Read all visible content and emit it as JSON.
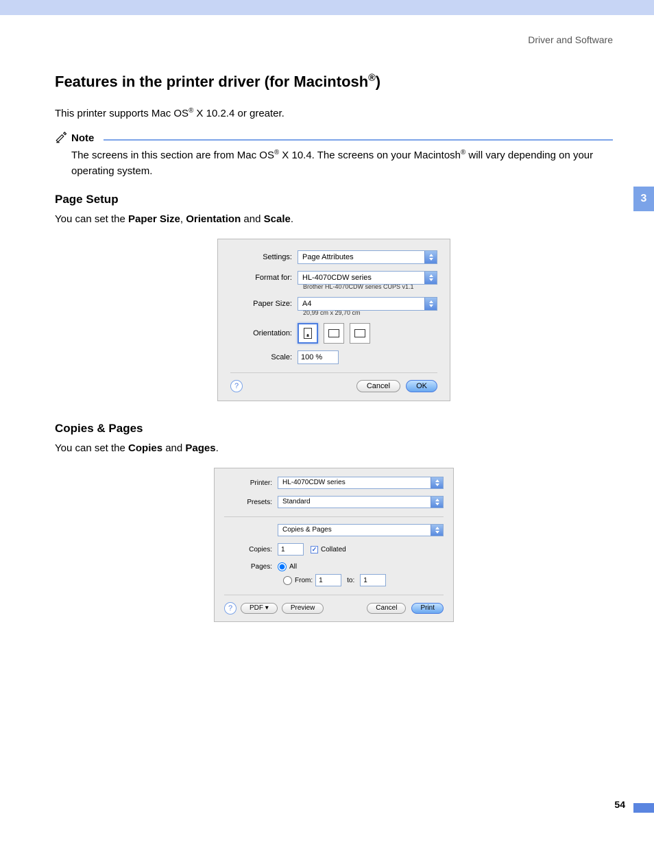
{
  "header": {
    "breadcrumb": "Driver and Software"
  },
  "chapter_tab": "3",
  "page_number": "54",
  "title_prefix": "Features in the printer driver (for Macintosh",
  "title_sup": "®",
  "title_suffix": ")",
  "intro_prefix": "This printer supports Mac OS",
  "intro_sup": "®",
  "intro_suffix": " X 10.2.4 or greater.",
  "note": {
    "label": "Note",
    "body_prefix": "The screens in this section are from Mac OS",
    "body_sup1": "®",
    "body_mid": " X 10.4. The screens on your Macintosh",
    "body_sup2": "®",
    "body_suffix": " will vary depending on your operating system."
  },
  "pagesetup": {
    "heading": "Page Setup",
    "desc_prefix": "You can set the ",
    "desc_b1": "Paper Size",
    "desc_sep1": ", ",
    "desc_b2": "Orientation",
    "desc_sep2": " and ",
    "desc_b3": "Scale",
    "desc_suffix": "."
  },
  "dlg1": {
    "settings_label": "Settings:",
    "settings_value": "Page Attributes",
    "formatfor_label": "Format for:",
    "formatfor_value": "HL-4070CDW series",
    "formatfor_sub": "Brother HL-4070CDW series CUPS v1.1",
    "papersize_label": "Paper Size:",
    "papersize_value": "A4",
    "papersize_sub": "20,99 cm x 29,70 cm",
    "orientation_label": "Orientation:",
    "scale_label": "Scale:",
    "scale_value": "100 %",
    "help": "?",
    "cancel": "Cancel",
    "ok": "OK"
  },
  "copies": {
    "heading": "Copies & Pages",
    "desc_prefix": "You can set the ",
    "desc_b1": "Copies",
    "desc_sep": " and ",
    "desc_b2": "Pages",
    "desc_suffix": "."
  },
  "dlg2": {
    "printer_label": "Printer:",
    "printer_value": "HL-4070CDW series",
    "presets_label": "Presets:",
    "presets_value": "Standard",
    "panel_value": "Copies & Pages",
    "copies_label": "Copies:",
    "copies_value": "1",
    "collated_label": "Collated",
    "collated_checkmark": "✓",
    "pages_label": "Pages:",
    "all_label": "All",
    "from_label": "From:",
    "from_value": "1",
    "to_label": "to:",
    "to_value": "1",
    "help": "?",
    "pdf": "PDF ▾",
    "preview": "Preview",
    "cancel": "Cancel",
    "print": "Print"
  }
}
